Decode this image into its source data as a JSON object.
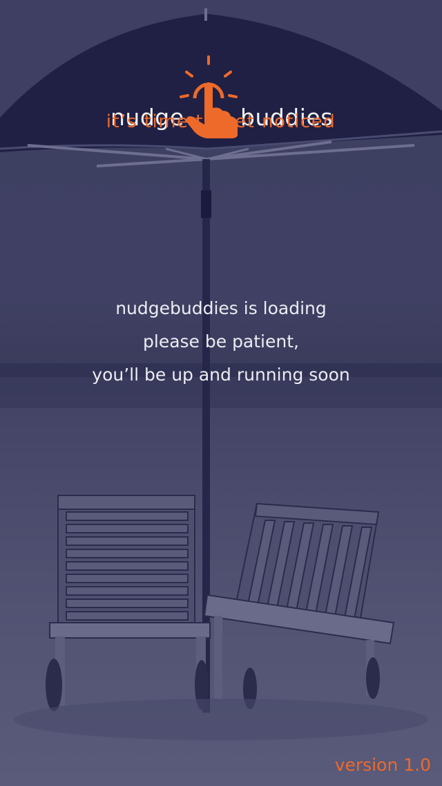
{
  "app": {
    "logo_left_word": "nudge",
    "logo_right_word": "buddies",
    "tagline": "it’s time to get noticed",
    "logo_icon": "tap-finger-icon"
  },
  "loading": {
    "line1": "nudgebuddies is loading",
    "line2": "please be patient,",
    "line3": "you’ll be up and running soon"
  },
  "footer": {
    "version": "version 1.0"
  },
  "colors": {
    "accent": "#ee6a2a",
    "text": "#ececf2",
    "background_tint": "#3e3f62"
  }
}
